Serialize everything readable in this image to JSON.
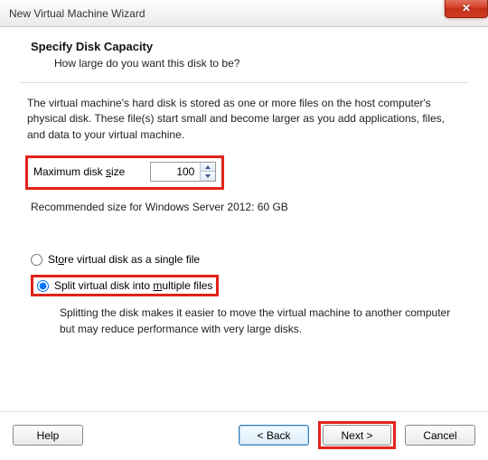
{
  "window": {
    "title": "New Virtual Machine Wizard",
    "close_glyph": "✕"
  },
  "header": {
    "title": "Specify Disk Capacity",
    "subtitle": "How large do you want this disk to be?"
  },
  "body": {
    "description": "The virtual machine's hard disk is stored as one or more files on the host computer's physical disk. These file(s) start small and become larger as you add applications, files, and data to your virtual machine.",
    "size_label_pre": "Maximum disk ",
    "size_label_u": "s",
    "size_label_post": "ize",
    "size_value": "100",
    "recommended": "Recommended size for Windows Server 2012: 60 GB"
  },
  "options": {
    "single_pre": "St",
    "single_u": "o",
    "single_post": "re virtual disk as a single file",
    "split_pre": "Split virtual disk into ",
    "split_u": "m",
    "split_post": "ultiple files",
    "split_note": "Splitting the disk makes it easier to move the virtual machine to another computer but may reduce performance with very large disks.",
    "selected": "split"
  },
  "footer": {
    "help": "Help",
    "back": "< Back",
    "next": "Next >",
    "cancel": "Cancel"
  }
}
